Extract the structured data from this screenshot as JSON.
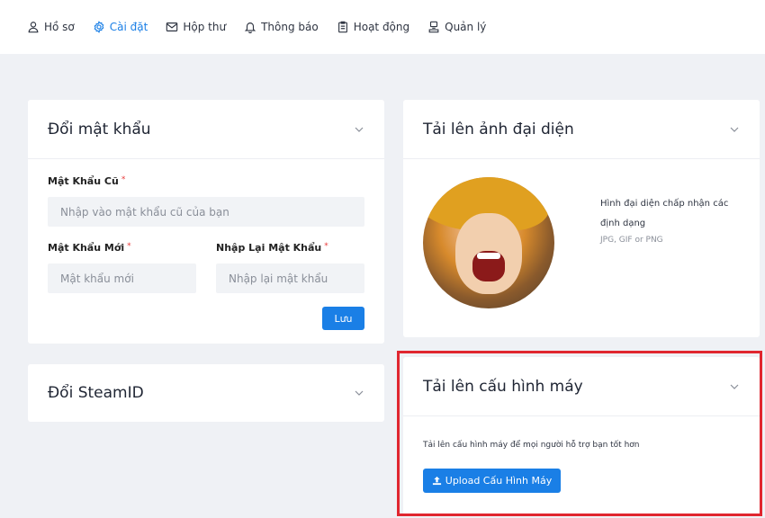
{
  "nav": {
    "items": [
      {
        "label": "Hồ sơ",
        "icon": "user-icon"
      },
      {
        "label": "Cài đặt",
        "icon": "gear-icon",
        "active": true
      },
      {
        "label": "Hộp thư",
        "icon": "mail-icon"
      },
      {
        "label": "Thông báo",
        "icon": "bell-icon"
      },
      {
        "label": "Hoạt động",
        "icon": "clipboard-icon"
      },
      {
        "label": "Quản lý",
        "icon": "admin-icon"
      }
    ]
  },
  "password_card": {
    "title": "Đổi mật khẩu",
    "old_label": "Mật Khẩu Cũ",
    "old_placeholder": "Nhập vào mật khẩu cũ của bạn",
    "new_label": "Mật Khẩu Mới",
    "new_placeholder": "Mật khẩu mới",
    "confirm_label": "Nhập Lại Mật Khẩu",
    "confirm_placeholder": "Nhập lại mật khẩu",
    "save_label": "Lưu",
    "required_mark": "*"
  },
  "steam_card": {
    "title": "Đổi SteamID"
  },
  "avatar_card": {
    "title": "Tải lên ảnh đại diện",
    "info_line": "Hình đại diện chấp nhận các định dạng",
    "formats": "JPG, GIF or PNG"
  },
  "config_card": {
    "title": "Tải lên cấu hình máy",
    "description": "Tải lên cấu hình máy để mọi người hỗ trợ bạn tốt hơn",
    "upload_label": "Upload Cấu Hình Máy"
  },
  "colors": {
    "accent": "#1a7fe6",
    "highlight": "#e0262f",
    "background": "#eff1f5"
  }
}
